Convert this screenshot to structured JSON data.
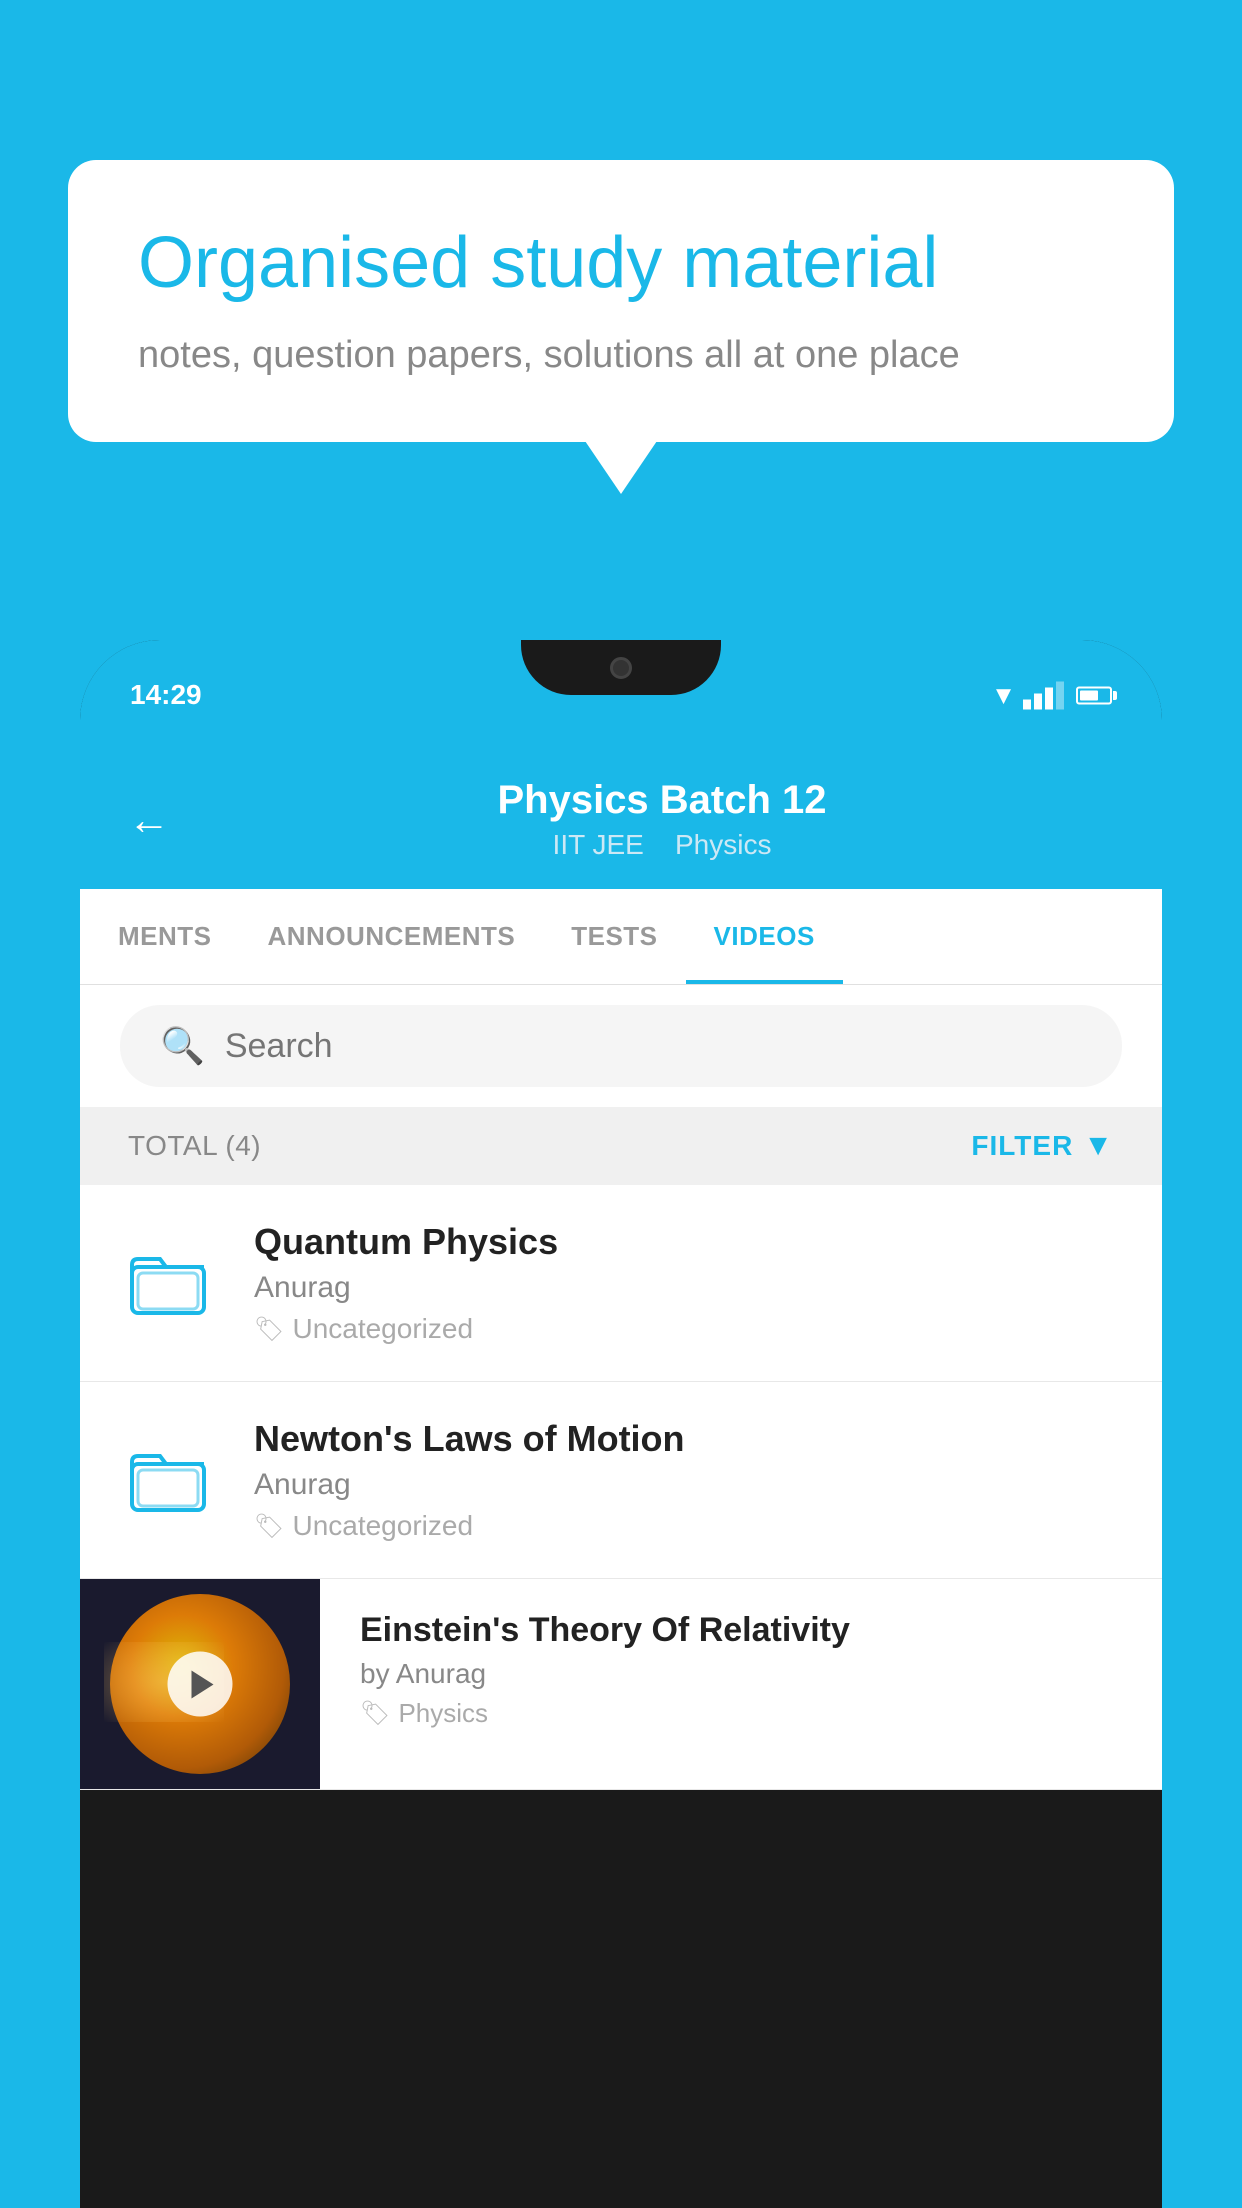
{
  "background_color": "#1ab8e8",
  "speech_bubble": {
    "headline": "Organised study material",
    "subtext": "notes, question papers, solutions all at one place"
  },
  "phone": {
    "status_bar": {
      "time": "14:29"
    },
    "app_header": {
      "back_label": "←",
      "title": "Physics Batch 12",
      "subtitle_parts": [
        "IIT JEE",
        "Physics"
      ]
    },
    "tabs": [
      {
        "label": "MENTS",
        "active": false
      },
      {
        "label": "ANNOUNCEMENTS",
        "active": false
      },
      {
        "label": "TESTS",
        "active": false
      },
      {
        "label": "VIDEOS",
        "active": true
      }
    ],
    "search": {
      "placeholder": "Search"
    },
    "total_filter": {
      "total_label": "TOTAL (4)",
      "filter_label": "FILTER"
    },
    "videos": [
      {
        "title": "Quantum Physics",
        "author": "Anurag",
        "tag": "Uncategorized",
        "has_thumbnail": false
      },
      {
        "title": "Newton's Laws of Motion",
        "author": "Anurag",
        "tag": "Uncategorized",
        "has_thumbnail": false
      },
      {
        "title": "Einstein's Theory Of Relativity",
        "author": "by Anurag",
        "tag": "Physics",
        "has_thumbnail": true
      }
    ]
  }
}
